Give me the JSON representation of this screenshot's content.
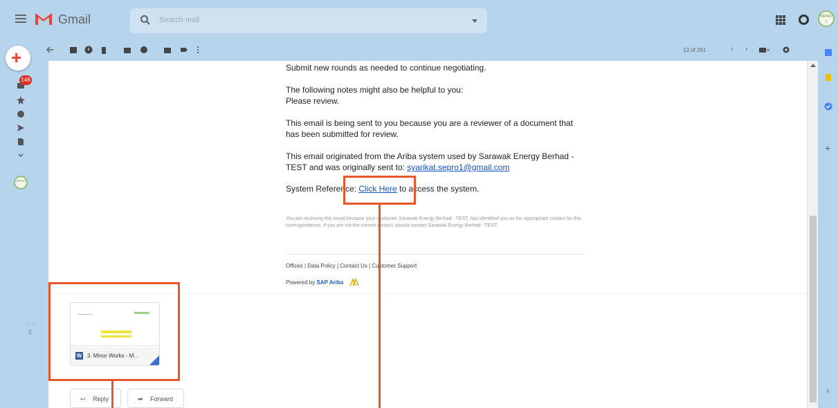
{
  "app": {
    "name": "Gmail",
    "search_placeholder": "Search mail",
    "compose_icon": "plus-icon",
    "inbox_badge": "146",
    "avatar_text": "SEPRO 1"
  },
  "toolbar": {
    "page_count": "13 of 261"
  },
  "email": {
    "line1": "Submit new rounds as needed to continue negotiating.",
    "notes_intro": "The following notes might also be helpful to you:",
    "notes_value": "Please review.",
    "reviewer_line1": "This email is being sent to you because you are a reviewer of a document that",
    "reviewer_line2": "has been submitted for review.",
    "origin_line1": "This email originated from the Ariba system used by Sarawak Energy Berhad -",
    "origin_line2_prefix": "TEST and was originally sent to: ",
    "origin_email": "syarikat.sepro1@gmail.com",
    "system_ref_prefix": "System Reference: ",
    "system_ref_link": "Click Here",
    "system_ref_suffix": " to access the system.",
    "footer_small": "You are receiving this email because your customer, Sarawak Energy Berhad - TEST, has identified you as the appropriate contact for this correspondence. If you are not the correct contact, please contact Sarawak Energy Berhad - TEST.",
    "footer_links": "Offices  |  Data Policy  |  Contact Us  |  Customer Support",
    "powered_prefix": "Powered by ",
    "powered_brand": "SAP Ariba"
  },
  "attachment": {
    "name": "3. Minor Works - M...",
    "type_letter": "W"
  },
  "actions": {
    "reply": "Reply",
    "forward": "Forward"
  },
  "rail": {
    "note_small": "No H",
    "note_letter": "E"
  },
  "colors": {
    "chrome": "#b6d4ec",
    "highlight": "#e8572a",
    "link": "#1155cc"
  }
}
